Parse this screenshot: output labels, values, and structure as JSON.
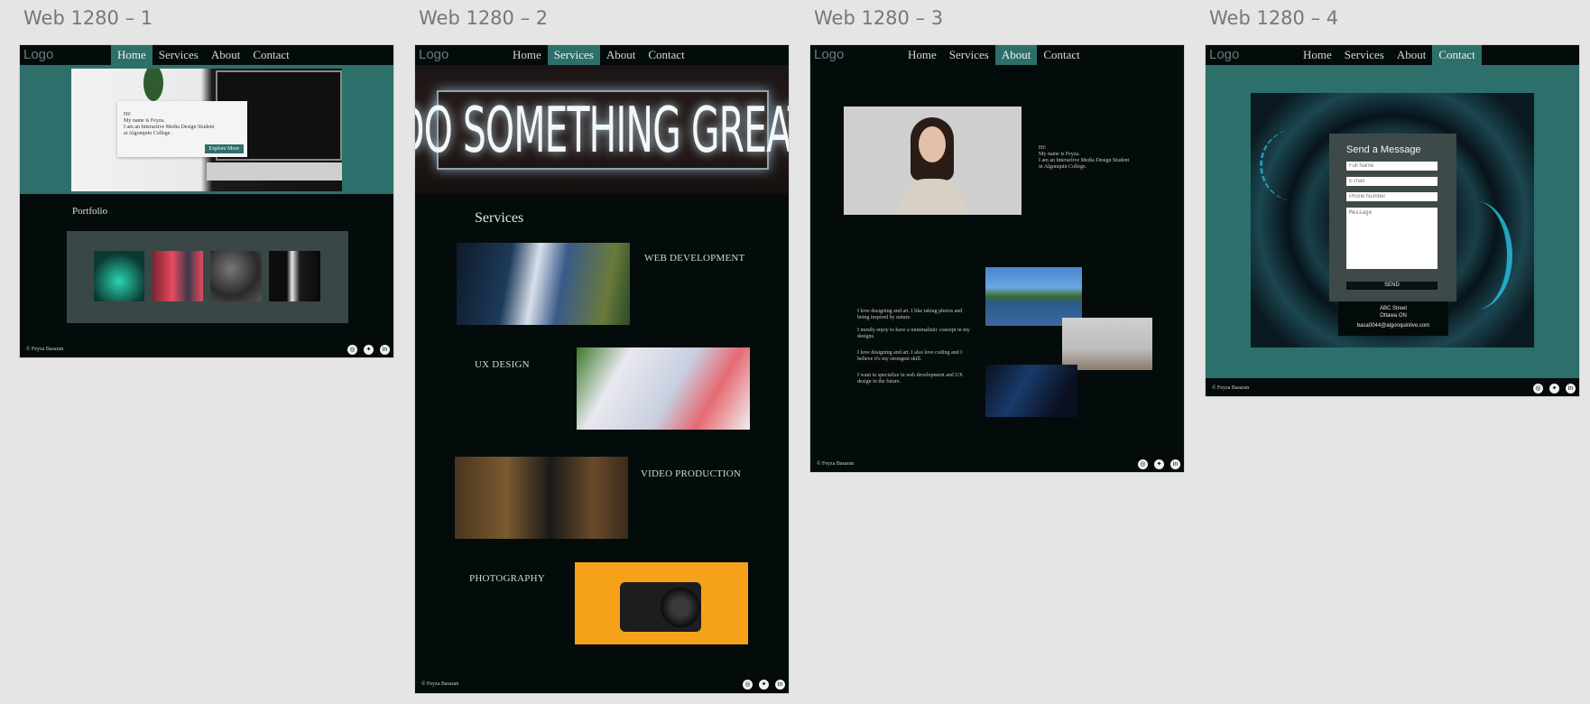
{
  "frames": [
    {
      "title": "Web 1280 – 1"
    },
    {
      "title": "Web 1280 – 2"
    },
    {
      "title": "Web 1280 – 3"
    },
    {
      "title": "Web 1280 – 4"
    }
  ],
  "nav": {
    "logo": "Logo",
    "items": [
      "Home",
      "Services",
      "About",
      "Contact"
    ]
  },
  "footer": {
    "copyright": "© Feyza Basaran",
    "icons": [
      "instagram-icon",
      "twitter-icon",
      "linkedin-icon"
    ]
  },
  "home": {
    "intro_lines": [
      "Hi!",
      "My name is Feyza.",
      "I am an Interactive Media Design Student",
      "at Algonquin College."
    ],
    "explore_button": "Explore More",
    "portfolio_title": "Portfolio"
  },
  "services": {
    "hero_text": "DO SOMETHING GREAT",
    "title": "Services",
    "items": [
      "WEB DEVELOPMENT",
      "UX DESIGN",
      "VIDEO PRODUCTION",
      "PHOTOGRAPHY"
    ]
  },
  "about": {
    "intro_lines": [
      "Hi!",
      "My name is Feyza.",
      "I am an Interactive Media Design Student",
      "in Algonquin College."
    ],
    "paragraphs": [
      "I love designing and art. I like taking photos and being inspired by nature.",
      "I mostly enjoy to have a minimalistic concept in my designs.",
      "I love designing and art. I also love coding and I believe it's my strongest skill.",
      "I want to specialize in web development and UX design in the future."
    ]
  },
  "contact": {
    "form_title": "Send a Message",
    "placeholders": [
      "Full Name",
      "E-mail",
      "Phone Number",
      "Message"
    ],
    "send_button": "SEND",
    "address_lines": [
      "ABC Street",
      "Ottawa ON",
      "basa0044@algonquinlive.com"
    ]
  },
  "colors": {
    "teal": "#2d6f6b",
    "dark": "#040b0b",
    "canvas": "#e5e5e5"
  }
}
